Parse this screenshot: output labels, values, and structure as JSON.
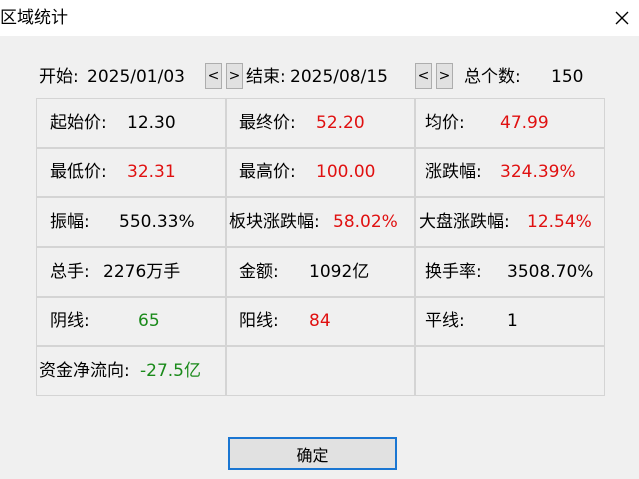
{
  "window": {
    "title": "区域统计"
  },
  "range": {
    "start_label": "开始:",
    "start_date": "2025/01/03",
    "end_label": "结束:",
    "end_date": "2025/08/15",
    "prev": "<",
    "next": ">",
    "count_label": "总个数:",
    "count": "150"
  },
  "stats": [
    [
      {
        "label": "起始价:",
        "value": "12.30",
        "color": "#000000"
      },
      {
        "label": "最终价:",
        "value": "52.20",
        "color": "#e01010"
      },
      {
        "label": "均价:",
        "value": "47.99",
        "color": "#e01010"
      }
    ],
    [
      {
        "label": "最低价:",
        "value": "32.31",
        "color": "#e01010"
      },
      {
        "label": "最高价:",
        "value": "100.00",
        "color": "#e01010"
      },
      {
        "label": "涨跌幅:",
        "value": "324.39%",
        "color": "#e01010"
      }
    ],
    [
      {
        "label": "振幅:",
        "value": "550.33%",
        "color": "#000000"
      },
      {
        "label": "板块涨跌幅:",
        "value": "58.02%",
        "color": "#e01010"
      },
      {
        "label": "大盘涨跌幅:",
        "value": "12.54%",
        "color": "#e01010"
      }
    ],
    [
      {
        "label": "总手:",
        "value": "2276万手",
        "color": "#000000"
      },
      {
        "label": "金额:",
        "value": "1092亿",
        "color": "#000000"
      },
      {
        "label": "换手率:",
        "value": "3508.70%",
        "color": "#000000"
      }
    ],
    [
      {
        "label": "阴线:",
        "value": "65",
        "color": "#1a8a1a"
      },
      {
        "label": "阳线:",
        "value": "84",
        "color": "#e01010"
      },
      {
        "label": "平线:",
        "value": "1",
        "color": "#000000"
      }
    ],
    [
      {
        "label": "资金净流向:",
        "value": "-27.5亿",
        "color": "#1a8a1a"
      }
    ]
  ],
  "buttons": {
    "ok": "确定"
  }
}
